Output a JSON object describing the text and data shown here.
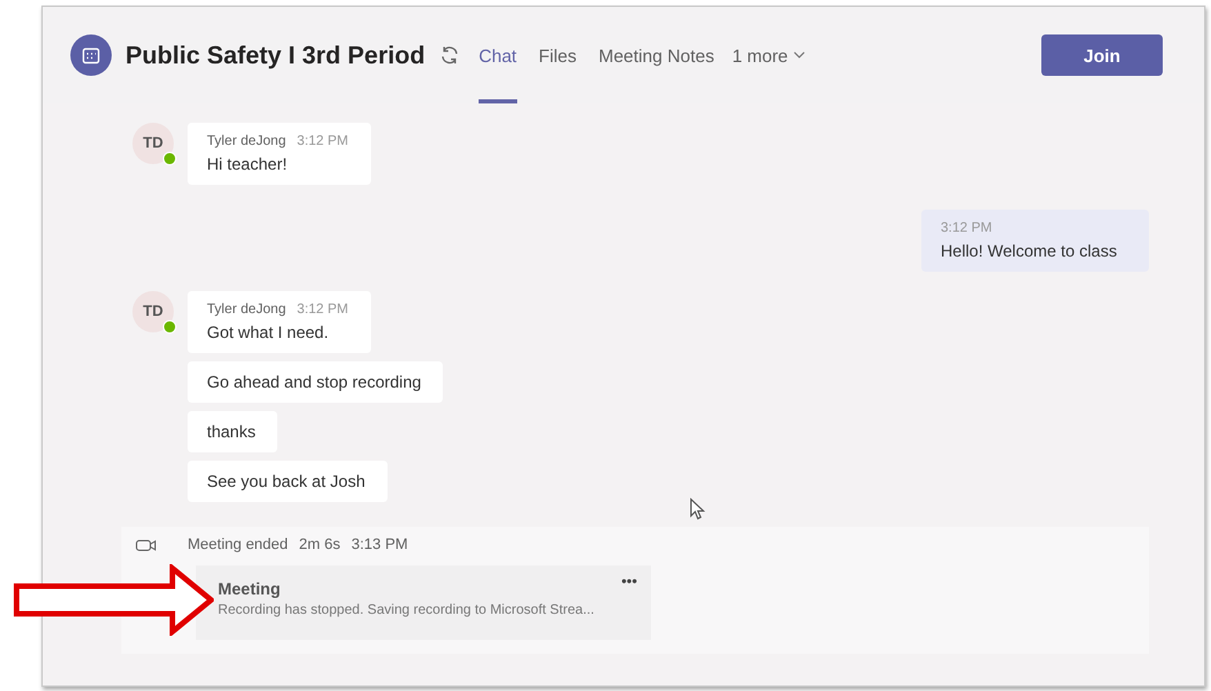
{
  "header": {
    "title": "Public Safety I 3rd Period",
    "tabs": [
      {
        "label": "Chat",
        "selected": true
      },
      {
        "label": "Files",
        "selected": false
      },
      {
        "label": "Meeting Notes",
        "selected": false
      }
    ],
    "more": "1 more",
    "join": "Join"
  },
  "messages": [
    {
      "kind": "incoming",
      "initials": "TD",
      "online": true,
      "author": "Tyler deJong",
      "time": "3:12 PM",
      "lines": [
        "Hi teacher!"
      ]
    },
    {
      "kind": "outgoing",
      "time": "3:12 PM",
      "lines": [
        "Hello!  Welcome to class"
      ]
    },
    {
      "kind": "incoming",
      "initials": "TD",
      "online": true,
      "author": "Tyler deJong",
      "time": "3:12 PM",
      "lines": [
        "Got what I need.",
        "Go ahead and stop recording",
        "thanks",
        "See you back at Josh"
      ]
    }
  ],
  "meeting": {
    "status": "Meeting ended",
    "duration": "2m 6s",
    "time": "3:13 PM",
    "card_title": "Meeting",
    "card_text": "Recording has stopped. Saving recording to Microsoft Strea...",
    "menu": "•••"
  }
}
